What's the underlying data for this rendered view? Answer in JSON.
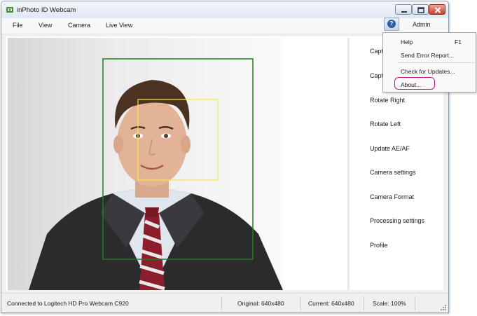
{
  "window": {
    "title": "inPhoto ID Webcam"
  },
  "menubar": {
    "items": [
      "File",
      "View",
      "Camera",
      "Live View"
    ],
    "user": "Admin"
  },
  "help_dropdown": {
    "items": [
      {
        "label": "Help",
        "shortcut": "F1"
      },
      {
        "label": "Send Error Report..."
      },
      {
        "label": "Check for Updates..."
      },
      {
        "label": "About..."
      }
    ]
  },
  "sidebar": {
    "items": [
      "Capt",
      "Capt",
      "Rotate Right",
      "Rotate Left",
      "Update AE/AF",
      "Camera settings",
      "Camera Format",
      "Processing settings",
      "Profile"
    ]
  },
  "status": {
    "connection": "Connected to Logitech HD Pro Webcam C920",
    "original": "Original: 640x480",
    "current": "Current: 640x480",
    "scale": "Scale: 100%"
  },
  "colors": {
    "face_frame": "#1a7f1a",
    "face_detect": "#f2ea4a",
    "highlight": "#c2187a",
    "help_icon": "#2f5ea8"
  }
}
